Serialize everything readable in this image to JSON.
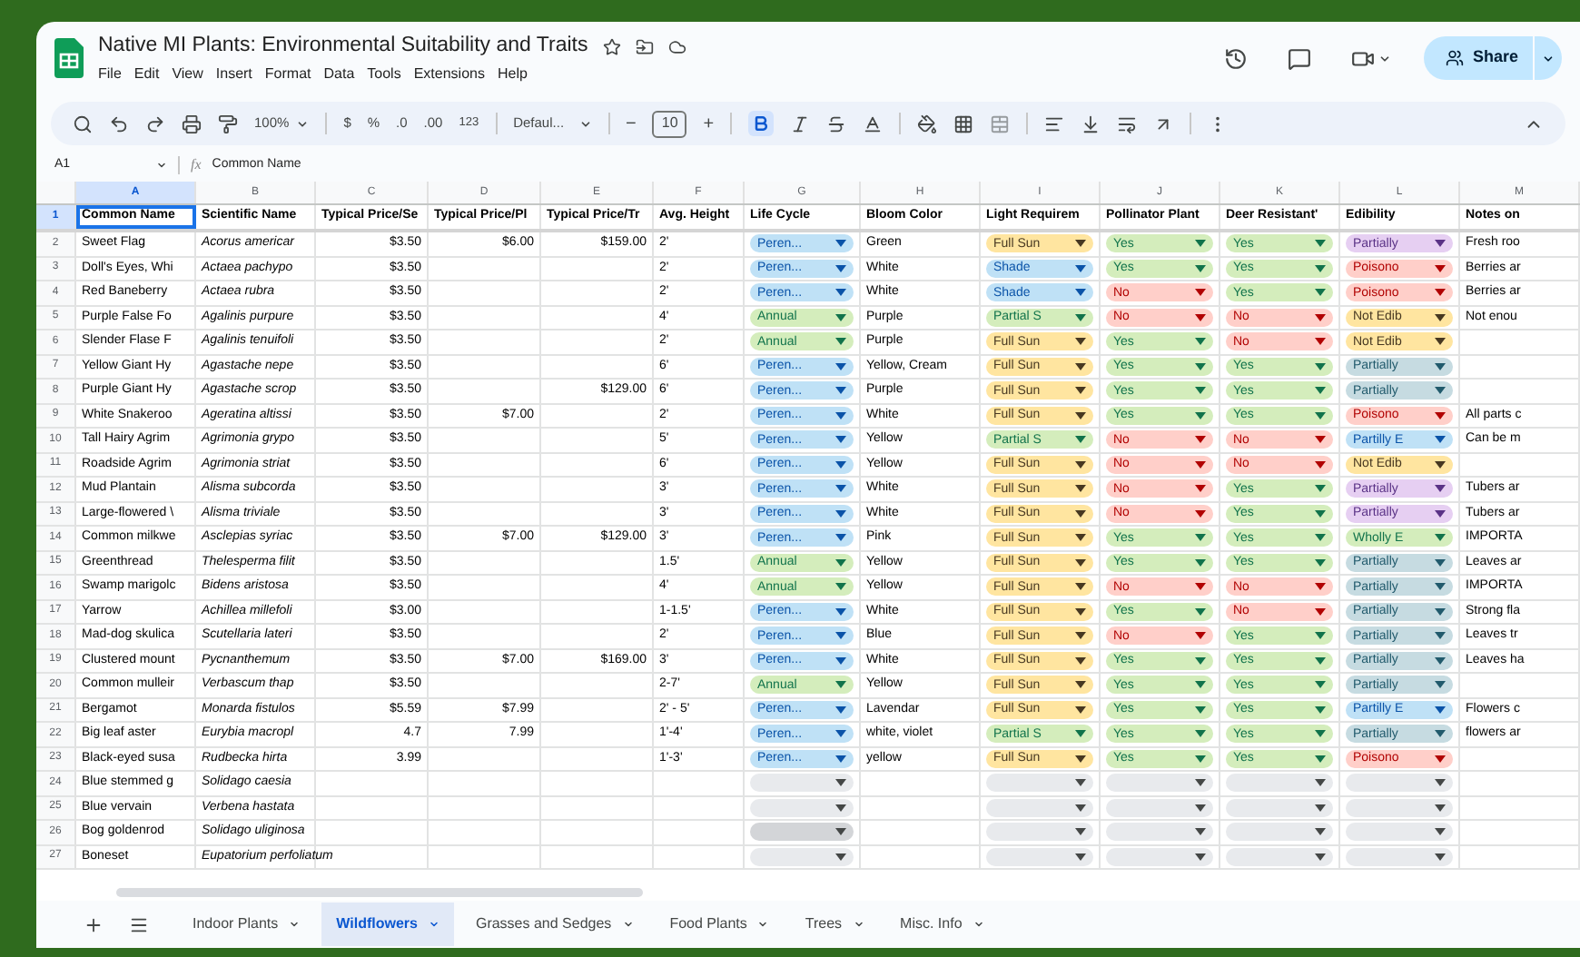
{
  "app": {
    "title": "Native MI Plants: Environmental Suitability and Traits",
    "menu": [
      "File",
      "Edit",
      "View",
      "Insert",
      "Format",
      "Data",
      "Tools",
      "Extensions",
      "Help"
    ],
    "share_label": "Share"
  },
  "toolbar": {
    "zoom": "100%",
    "currency": "$",
    "percent": "%",
    "decrease_decimals": ".0",
    "increase_decimals": ".00",
    "number_format": "123",
    "font": "Defaul...",
    "minus": "−",
    "font_size": "10",
    "plus": "+",
    "bold_on": true
  },
  "formula_bar": {
    "cell_ref": "A1",
    "fx": "fx",
    "content": "Common Name"
  },
  "columns": [
    {
      "letter": "A",
      "selected": true
    },
    {
      "letter": "B",
      "selected": false
    },
    {
      "letter": "C",
      "selected": false
    },
    {
      "letter": "D",
      "selected": false
    },
    {
      "letter": "E",
      "selected": false
    },
    {
      "letter": "F",
      "selected": false
    },
    {
      "letter": "G",
      "selected": false
    },
    {
      "letter": "H",
      "selected": false
    },
    {
      "letter": "I",
      "selected": false
    },
    {
      "letter": "J",
      "selected": false
    },
    {
      "letter": "K",
      "selected": false
    },
    {
      "letter": "L",
      "selected": false
    },
    {
      "letter": "M",
      "selected": false
    }
  ],
  "header_row": {
    "num": "1",
    "selected": true,
    "cells": [
      "Common Name",
      "Scientific Name",
      "Typical Price/Se",
      "Typical Price/Pl",
      "Typical Price/Tr",
      "Avg. Height",
      "Life Cycle",
      "Bloom Color",
      "Light Requirem",
      "Pollinator Plant",
      "Deer Resistant'",
      "Edibility",
      "Notes on"
    ]
  },
  "rows": [
    {
      "num": "2",
      "common_name": "Sweet Flag",
      "scientific_name": "Acorus americar",
      "price_seed": "$3.50",
      "price_plug": "$6.00",
      "price_tray": "$159.00",
      "avg_height": "2'",
      "life_cycle": {
        "text": "Peren...",
        "color": "#bfe1f6"
      },
      "bloom_color": "Green",
      "light": {
        "text": "Full Sun",
        "color": "#ffe5a0"
      },
      "pollinator": {
        "text": "Yes",
        "color": "#d4edbc"
      },
      "deer_resistant": {
        "text": "Yes",
        "color": "#d4edbc"
      },
      "edibility": {
        "text": "Partially",
        "color": "#e6cff2"
      },
      "notes": "Fresh roo"
    },
    {
      "num": "3",
      "common_name": "Doll's Eyes, Whi",
      "scientific_name": "Actaea pachypo",
      "price_seed": "$3.50",
      "avg_height": "2'",
      "life_cycle": {
        "text": "Peren...",
        "color": "#bfe1f6"
      },
      "bloom_color": "White",
      "light": {
        "text": "Shade",
        "color": "#bfe1f6"
      },
      "pollinator": {
        "text": "Yes",
        "color": "#d4edbc"
      },
      "deer_resistant": {
        "text": "Yes",
        "color": "#d4edbc"
      },
      "edibility": {
        "text": "Poisono",
        "color": "#ffcfc9"
      },
      "notes": "Berries ar"
    },
    {
      "num": "4",
      "common_name": "Red Baneberry",
      "scientific_name": "Actaea rubra",
      "price_seed": "$3.50",
      "avg_height": "2'",
      "life_cycle": {
        "text": "Peren...",
        "color": "#bfe1f6"
      },
      "bloom_color": "White",
      "light": {
        "text": "Shade",
        "color": "#bfe1f6"
      },
      "pollinator": {
        "text": "No",
        "color": "#ffcfc9"
      },
      "deer_resistant": {
        "text": "Yes",
        "color": "#d4edbc"
      },
      "edibility": {
        "text": "Poisono",
        "color": "#ffcfc9"
      },
      "notes": "Berries ar"
    },
    {
      "num": "5",
      "common_name": "Purple False Fo",
      "scientific_name": "Agalinis purpure",
      "price_seed": "$3.50",
      "avg_height": "4'",
      "life_cycle": {
        "text": "Annual",
        "color": "#d4edbc"
      },
      "bloom_color": "Purple",
      "light": {
        "text": "Partial S",
        "color": "#d4edbc"
      },
      "pollinator": {
        "text": "No",
        "color": "#ffcfc9"
      },
      "deer_resistant": {
        "text": "No",
        "color": "#ffcfc9"
      },
      "edibility": {
        "text": "Not Edib",
        "color": "#ffe5a0"
      },
      "notes": "Not enou"
    },
    {
      "num": "6",
      "common_name": "Slender Flase F",
      "scientific_name": "Agalinis tenuifoli",
      "price_seed": "$3.50",
      "avg_height": "2'",
      "life_cycle": {
        "text": "Annual",
        "color": "#d4edbc"
      },
      "bloom_color": "Purple",
      "light": {
        "text": "Full Sun",
        "color": "#ffe5a0"
      },
      "pollinator": {
        "text": "Yes",
        "color": "#d4edbc"
      },
      "deer_resistant": {
        "text": "No",
        "color": "#ffcfc9"
      },
      "edibility": {
        "text": "Not Edib",
        "color": "#ffe5a0"
      }
    },
    {
      "num": "7",
      "common_name": "Yellow Giant Hy",
      "scientific_name": "Agastache nepe",
      "price_seed": "$3.50",
      "avg_height": "6'",
      "life_cycle": {
        "text": "Peren...",
        "color": "#bfe1f6"
      },
      "bloom_color": "Yellow, Cream",
      "light": {
        "text": "Full Sun",
        "color": "#ffe5a0"
      },
      "pollinator": {
        "text": "Yes",
        "color": "#d4edbc"
      },
      "deer_resistant": {
        "text": "Yes",
        "color": "#d4edbc"
      },
      "edibility": {
        "text": "Partially",
        "color": "#c6dbe1"
      }
    },
    {
      "num": "8",
      "common_name": "Purple Giant Hy",
      "scientific_name": "Agastache scrop",
      "price_seed": "$3.50",
      "price_tray": "$129.00",
      "avg_height": "6'",
      "life_cycle": {
        "text": "Peren...",
        "color": "#bfe1f6"
      },
      "bloom_color": "Purple",
      "light": {
        "text": "Full Sun",
        "color": "#ffe5a0"
      },
      "pollinator": {
        "text": "Yes",
        "color": "#d4edbc"
      },
      "deer_resistant": {
        "text": "Yes",
        "color": "#d4edbc"
      },
      "edibility": {
        "text": "Partially",
        "color": "#c6dbe1"
      }
    },
    {
      "num": "9",
      "common_name": "White Snakeroo",
      "scientific_name": "Ageratina altissi",
      "price_seed": "$3.50",
      "price_plug": "$7.00",
      "avg_height": "2'",
      "life_cycle": {
        "text": "Peren...",
        "color": "#bfe1f6"
      },
      "bloom_color": "White",
      "light": {
        "text": "Full Sun",
        "color": "#ffe5a0"
      },
      "pollinator": {
        "text": "Yes",
        "color": "#d4edbc"
      },
      "deer_resistant": {
        "text": "Yes",
        "color": "#d4edbc"
      },
      "edibility": {
        "text": "Poisono",
        "color": "#ffcfc9"
      },
      "notes": "All parts c"
    },
    {
      "num": "10",
      "common_name": "Tall Hairy Agrim",
      "scientific_name": "Agrimonia grypo",
      "price_seed": "$3.50",
      "avg_height": "5'",
      "life_cycle": {
        "text": "Peren...",
        "color": "#bfe1f6"
      },
      "bloom_color": "Yellow",
      "light": {
        "text": "Partial S",
        "color": "#d4edbc"
      },
      "pollinator": {
        "text": "No",
        "color": "#ffcfc9"
      },
      "deer_resistant": {
        "text": "No",
        "color": "#ffcfc9"
      },
      "edibility": {
        "text": "Partilly E",
        "color": "#bfe1f6"
      },
      "notes": "Can be m"
    },
    {
      "num": "11",
      "common_name": "Roadside Agrim",
      "scientific_name": "Agrimonia striat",
      "price_seed": "$3.50",
      "avg_height": "6'",
      "life_cycle": {
        "text": "Peren...",
        "color": "#bfe1f6"
      },
      "bloom_color": "Yellow",
      "light": {
        "text": "Full Sun",
        "color": "#ffe5a0"
      },
      "pollinator": {
        "text": "No",
        "color": "#ffcfc9"
      },
      "deer_resistant": {
        "text": "No",
        "color": "#ffcfc9"
      },
      "edibility": {
        "text": "Not Edib",
        "color": "#ffe5a0"
      }
    },
    {
      "num": "12",
      "common_name": "Mud Plantain",
      "scientific_name": "Alisma subcorda",
      "price_seed": "$3.50",
      "avg_height": "3'",
      "life_cycle": {
        "text": "Peren...",
        "color": "#bfe1f6"
      },
      "bloom_color": "White",
      "light": {
        "text": "Full Sun",
        "color": "#ffe5a0"
      },
      "pollinator": {
        "text": "No",
        "color": "#ffcfc9"
      },
      "deer_resistant": {
        "text": "Yes",
        "color": "#d4edbc"
      },
      "edibility": {
        "text": "Partially",
        "color": "#e6cff2"
      },
      "notes": "Tubers ar"
    },
    {
      "num": "13",
      "common_name": "Large-flowered \\",
      "scientific_name": "Alisma triviale",
      "price_seed": "$3.50",
      "avg_height": "3'",
      "life_cycle": {
        "text": "Peren...",
        "color": "#bfe1f6"
      },
      "bloom_color": "White",
      "light": {
        "text": "Full Sun",
        "color": "#ffe5a0"
      },
      "pollinator": {
        "text": "No",
        "color": "#ffcfc9"
      },
      "deer_resistant": {
        "text": "Yes",
        "color": "#d4edbc"
      },
      "edibility": {
        "text": "Partially",
        "color": "#e6cff2"
      },
      "notes": "Tubers ar"
    },
    {
      "num": "14",
      "common_name": "Common milkwe",
      "scientific_name": "Asclepias syriac",
      "price_seed": "$3.50",
      "price_plug": "$7.00",
      "price_tray": "$129.00",
      "avg_height": "3'",
      "life_cycle": {
        "text": "Peren...",
        "color": "#bfe1f6"
      },
      "bloom_color": "Pink",
      "light": {
        "text": "Full Sun",
        "color": "#ffe5a0"
      },
      "pollinator": {
        "text": "Yes",
        "color": "#d4edbc"
      },
      "deer_resistant": {
        "text": "Yes",
        "color": "#d4edbc"
      },
      "edibility": {
        "text": "Wholly E",
        "color": "#d4edbc"
      },
      "notes": "IMPORTA"
    },
    {
      "num": "15",
      "common_name": "Greenthread",
      "scientific_name": "Thelesperma filit",
      "price_seed": "$3.50",
      "avg_height": "1.5'",
      "life_cycle": {
        "text": "Annual",
        "color": "#d4edbc"
      },
      "bloom_color": "Yellow",
      "light": {
        "text": "Full Sun",
        "color": "#ffe5a0"
      },
      "pollinator": {
        "text": "Yes",
        "color": "#d4edbc"
      },
      "deer_resistant": {
        "text": "Yes",
        "color": "#d4edbc"
      },
      "edibility": {
        "text": "Partially",
        "color": "#c6dbe1"
      },
      "notes": "Leaves ar"
    },
    {
      "num": "16",
      "common_name": "Swamp marigolc",
      "scientific_name": "Bidens aristosa",
      "price_seed": "$3.50",
      "avg_height": "4'",
      "life_cycle": {
        "text": "Annual",
        "color": "#d4edbc"
      },
      "bloom_color": "Yellow",
      "light": {
        "text": "Full Sun",
        "color": "#ffe5a0"
      },
      "pollinator": {
        "text": "No",
        "color": "#ffcfc9"
      },
      "deer_resistant": {
        "text": "No",
        "color": "#ffcfc9"
      },
      "edibility": {
        "text": "Partially",
        "color": "#c6dbe1"
      },
      "notes": "IMPORTA"
    },
    {
      "num": "17",
      "common_name": "Yarrow",
      "scientific_name": "Achillea millefoli",
      "price_seed": "$3.00",
      "avg_height": "1-1.5'",
      "life_cycle": {
        "text": "Peren...",
        "color": "#bfe1f6"
      },
      "bloom_color": "White",
      "light": {
        "text": "Full Sun",
        "color": "#ffe5a0"
      },
      "pollinator": {
        "text": "Yes",
        "color": "#d4edbc"
      },
      "deer_resistant": {
        "text": "No",
        "color": "#ffcfc9"
      },
      "edibility": {
        "text": "Partially",
        "color": "#c6dbe1"
      },
      "notes": "Strong fla"
    },
    {
      "num": "18",
      "common_name": "Mad-dog skulica",
      "scientific_name": "Scutellaria lateri",
      "price_seed": "$3.50",
      "avg_height": "2'",
      "life_cycle": {
        "text": "Peren...",
        "color": "#bfe1f6"
      },
      "bloom_color": "Blue",
      "light": {
        "text": "Full Sun",
        "color": "#ffe5a0"
      },
      "pollinator": {
        "text": "No",
        "color": "#ffcfc9"
      },
      "deer_resistant": {
        "text": "Yes",
        "color": "#d4edbc"
      },
      "edibility": {
        "text": "Partially",
        "color": "#c6dbe1"
      },
      "notes": "Leaves tr"
    },
    {
      "num": "19",
      "common_name": "Clustered mount",
      "scientific_name": "Pycnanthemum",
      "price_seed": "$3.50",
      "price_plug": "$7.00",
      "price_tray": "$169.00",
      "avg_height": "3'",
      "life_cycle": {
        "text": "Peren...",
        "color": "#bfe1f6"
      },
      "bloom_color": "White",
      "light": {
        "text": "Full Sun",
        "color": "#ffe5a0"
      },
      "pollinator": {
        "text": "Yes",
        "color": "#d4edbc"
      },
      "deer_resistant": {
        "text": "Yes",
        "color": "#d4edbc"
      },
      "edibility": {
        "text": "Partially",
        "color": "#c6dbe1"
      },
      "notes": "Leaves ha"
    },
    {
      "num": "20",
      "common_name": "Common mulleir",
      "scientific_name": "Verbascum thap",
      "price_seed": "$3.50",
      "avg_height": "2-7'",
      "life_cycle": {
        "text": "Annual",
        "color": "#d4edbc"
      },
      "bloom_color": "Yellow",
      "light": {
        "text": "Full Sun",
        "color": "#ffe5a0"
      },
      "pollinator": {
        "text": "Yes",
        "color": "#d4edbc"
      },
      "deer_resistant": {
        "text": "Yes",
        "color": "#d4edbc"
      },
      "edibility": {
        "text": "Partially",
        "color": "#c6dbe1"
      }
    },
    {
      "num": "21",
      "common_name": "Bergamot",
      "scientific_name": "Monarda fistulos",
      "price_seed": "$5.59",
      "price_plug": "$7.99",
      "avg_height": "2' - 5'",
      "life_cycle": {
        "text": "Peren...",
        "color": "#bfe1f6"
      },
      "bloom_color": "Lavendar",
      "light": {
        "text": "Full Sun",
        "color": "#ffe5a0"
      },
      "pollinator": {
        "text": "Yes",
        "color": "#d4edbc"
      },
      "deer_resistant": {
        "text": "Yes",
        "color": "#d4edbc"
      },
      "edibility": {
        "text": "Partilly E",
        "color": "#bfe1f6"
      },
      "notes": "Flowers c"
    },
    {
      "num": "22",
      "common_name": "Big leaf aster",
      "scientific_name": "Eurybia macropl",
      "price_seed": "4.7",
      "price_plug": "7.99",
      "avg_height": "1'-4'",
      "life_cycle": {
        "text": "Peren...",
        "color": "#bfe1f6"
      },
      "bloom_color": "white, violet",
      "light": {
        "text": "Partial S",
        "color": "#d4edbc"
      },
      "pollinator": {
        "text": "Yes",
        "color": "#d4edbc"
      },
      "deer_resistant": {
        "text": "Yes",
        "color": "#d4edbc"
      },
      "edibility": {
        "text": "Partially",
        "color": "#c6dbe1"
      },
      "notes": "flowers ar"
    },
    {
      "num": "23",
      "common_name": "Black-eyed susa",
      "scientific_name": "Rudbecka hirta",
      "price_seed": "3.99",
      "avg_height": "1'-3'",
      "life_cycle": {
        "text": "Peren...",
        "color": "#bfe1f6"
      },
      "bloom_color": "yellow",
      "light": {
        "text": "Full Sun",
        "color": "#ffe5a0"
      },
      "pollinator": {
        "text": "Yes",
        "color": "#d4edbc"
      },
      "deer_resistant": {
        "text": "Yes",
        "color": "#d4edbc"
      },
      "edibility": {
        "text": "Poisono",
        "color": "#ffcfc9"
      }
    },
    {
      "num": "24",
      "common_name": "Blue stemmed g",
      "scientific_name": "Solidago caesia",
      "life_cycle": {
        "color": "#e8eaed"
      },
      "light": {
        "color": "#e8eaed"
      },
      "pollinator": {
        "color": "#e8eaed"
      },
      "deer_resistant": {
        "color": "#e8eaed"
      },
      "edibility": {
        "color": "#e8eaed"
      }
    },
    {
      "num": "25",
      "common_name": "Blue vervain",
      "scientific_name": "Verbena hastata",
      "life_cycle": {
        "color": "#e8eaed"
      },
      "light": {
        "color": "#e8eaed"
      },
      "pollinator": {
        "color": "#e8eaed"
      },
      "deer_resistant": {
        "color": "#e8eaed"
      },
      "edibility": {
        "color": "#e8eaed"
      }
    },
    {
      "num": "26",
      "common_name": "Bog goldenrod",
      "scientific_name": "Solidago uliginosa",
      "life_cycle": {
        "color": "#d3d5d8"
      },
      "light": {
        "color": "#e8eaed"
      },
      "pollinator": {
        "color": "#e8eaed"
      },
      "deer_resistant": {
        "color": "#e8eaed"
      },
      "edibility": {
        "color": "#e8eaed"
      }
    },
    {
      "num": "27",
      "common_name": "Boneset",
      "scientific_name": "Eupatorium perfoliatum",
      "life_cycle": {
        "color": "#e8eaed"
      },
      "light": {
        "color": "#e8eaed"
      },
      "pollinator": {
        "color": "#e8eaed"
      },
      "deer_resistant": {
        "color": "#e8eaed"
      },
      "edibility": {
        "color": "#e8eaed"
      }
    }
  ],
  "sheet_tabs": [
    {
      "label": "Indoor Plants",
      "selected": false
    },
    {
      "label": "Wildflowers",
      "selected": true
    },
    {
      "label": "Grasses and Sedges",
      "selected": false
    },
    {
      "label": "Food Plants",
      "selected": false
    },
    {
      "label": "Trees",
      "selected": false
    },
    {
      "label": "Misc. Info",
      "selected": false
    }
  ]
}
